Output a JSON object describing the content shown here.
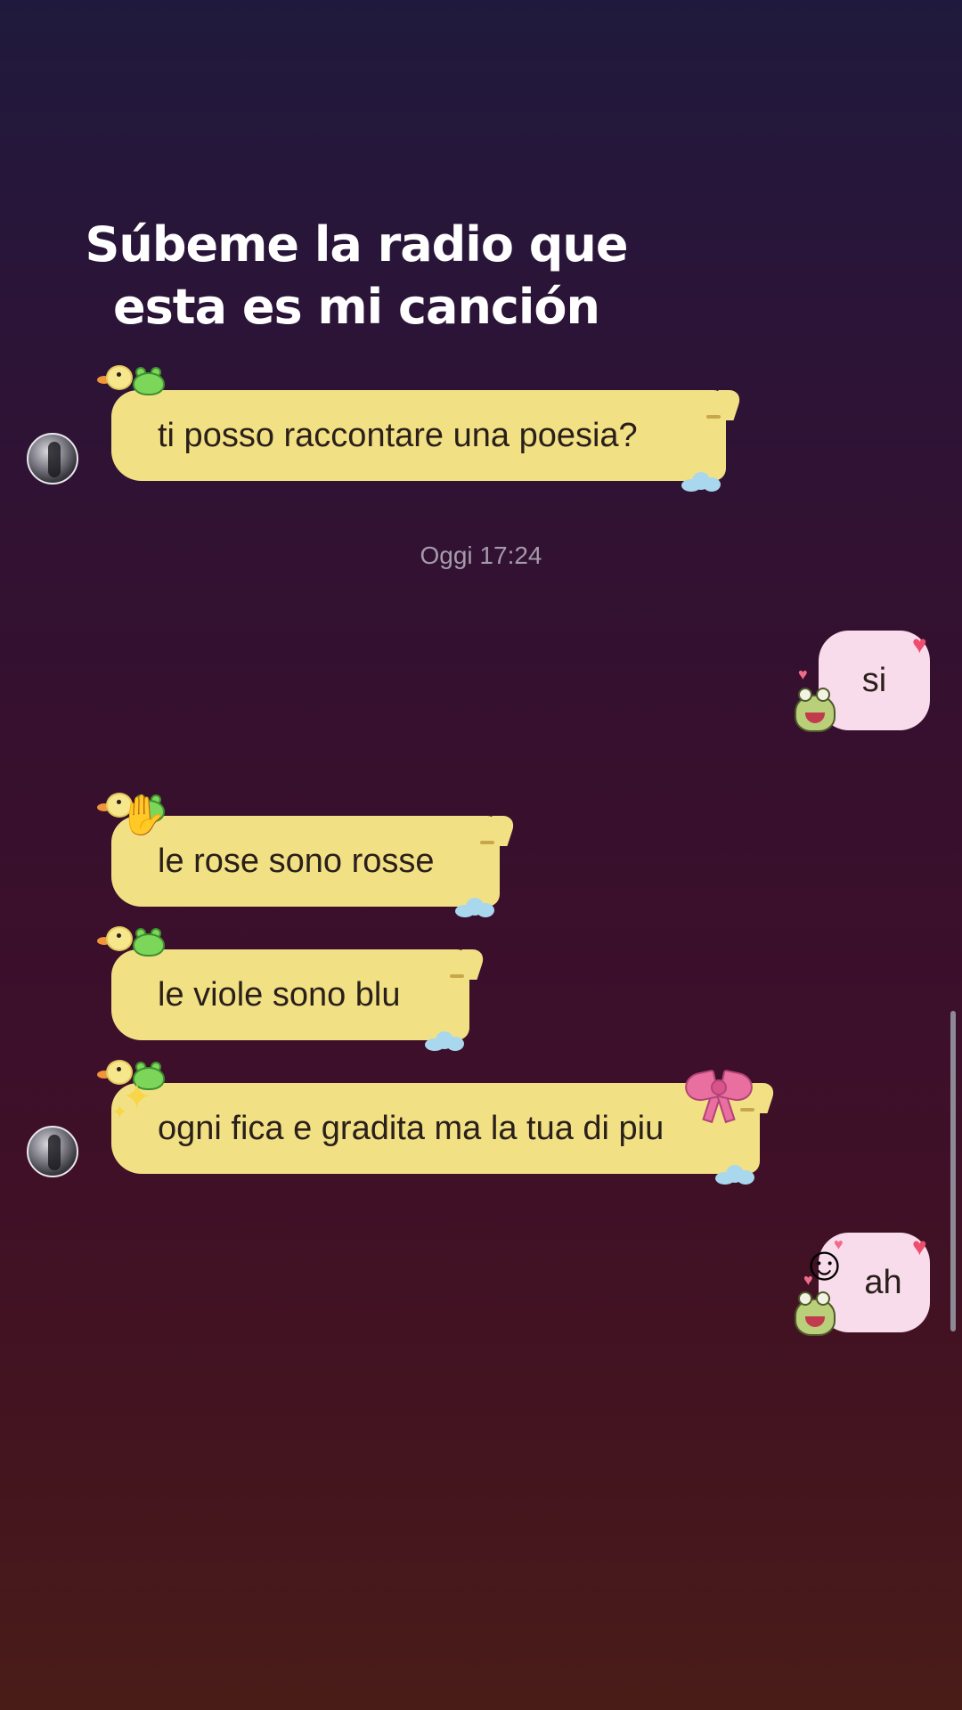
{
  "caption": {
    "line1": "Súbeme la radio que",
    "line2": "esta es mi canción"
  },
  "chat": {
    "timestamp": "Oggi 17:24",
    "messages": [
      {
        "direction": "incoming",
        "text": "ti posso raccontare una poesia?",
        "sticker": "duck-frog"
      },
      {
        "direction": "outgoing",
        "text": "si",
        "sticker": "frog-hearts"
      },
      {
        "direction": "incoming",
        "text": "le rose sono rosse",
        "sticker": "duck-frog-hand"
      },
      {
        "direction": "incoming",
        "text": "le viole sono blu",
        "sticker": "duck-frog"
      },
      {
        "direction": "incoming",
        "text": "ogni fica e gradita ma la tua di piu",
        "sticker": "duck-frog-sparkles-bow"
      },
      {
        "direction": "outgoing",
        "text": "ah",
        "sticker": "frog-hearts-smiling-face"
      }
    ]
  },
  "colors": {
    "incoming_bubble": "#f1e184",
    "outgoing_bubble": "#f9dceb",
    "timestamp_text": "#a59aaa"
  }
}
